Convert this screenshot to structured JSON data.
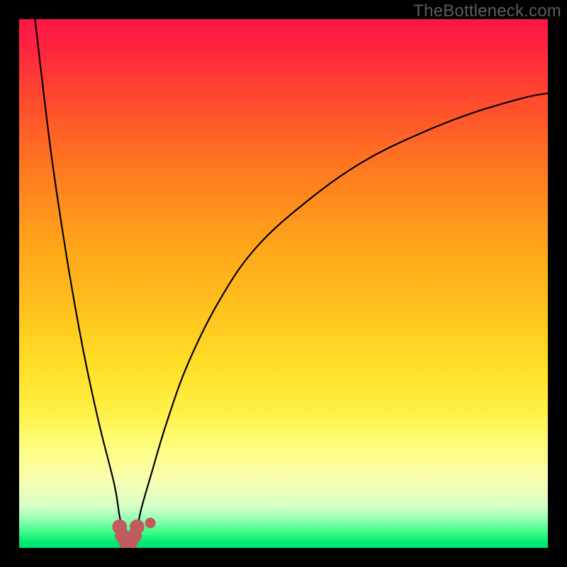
{
  "watermark": "TheBottleneck.com",
  "colors": {
    "background": "#000000",
    "curve": "#000000",
    "marker": "#c15b5f",
    "gradient_top": "#fd1646",
    "gradient_bottom": "#00e874"
  },
  "chart_data": {
    "type": "line",
    "title": "",
    "xlabel": "",
    "ylabel": "",
    "xlim": [
      0,
      100
    ],
    "ylim": [
      0,
      100
    ],
    "x": [
      0,
      3,
      6,
      9,
      12,
      15,
      18,
      19,
      20,
      21,
      22,
      23,
      25,
      28,
      32,
      38,
      45,
      55,
      65,
      75,
      85,
      95,
      100
    ],
    "series": [
      {
        "name": "left-curve",
        "values": [
          null,
          100,
          75,
          55,
          38,
          24,
          12,
          6,
          2,
          0.5,
          null,
          null,
          null,
          null,
          null,
          null,
          null,
          null,
          null,
          null,
          null,
          null,
          null
        ]
      },
      {
        "name": "right-curve",
        "values": [
          null,
          null,
          null,
          null,
          null,
          null,
          null,
          null,
          null,
          0.5,
          2,
          7,
          14,
          24,
          35,
          47,
          57,
          66,
          73,
          78,
          82,
          85,
          86
        ]
      }
    ],
    "markers": [
      {
        "x": 19.0,
        "y": 4.0,
        "r": 1.4
      },
      {
        "x": 19.5,
        "y": 2.3,
        "r": 1.4
      },
      {
        "x": 20.2,
        "y": 1.1,
        "r": 1.4
      },
      {
        "x": 21.1,
        "y": 1.1,
        "r": 1.4
      },
      {
        "x": 21.8,
        "y": 2.3,
        "r": 1.4
      },
      {
        "x": 22.3,
        "y": 4.0,
        "r": 1.4
      },
      {
        "x": 24.8,
        "y": 4.7,
        "r": 1.0
      }
    ]
  }
}
